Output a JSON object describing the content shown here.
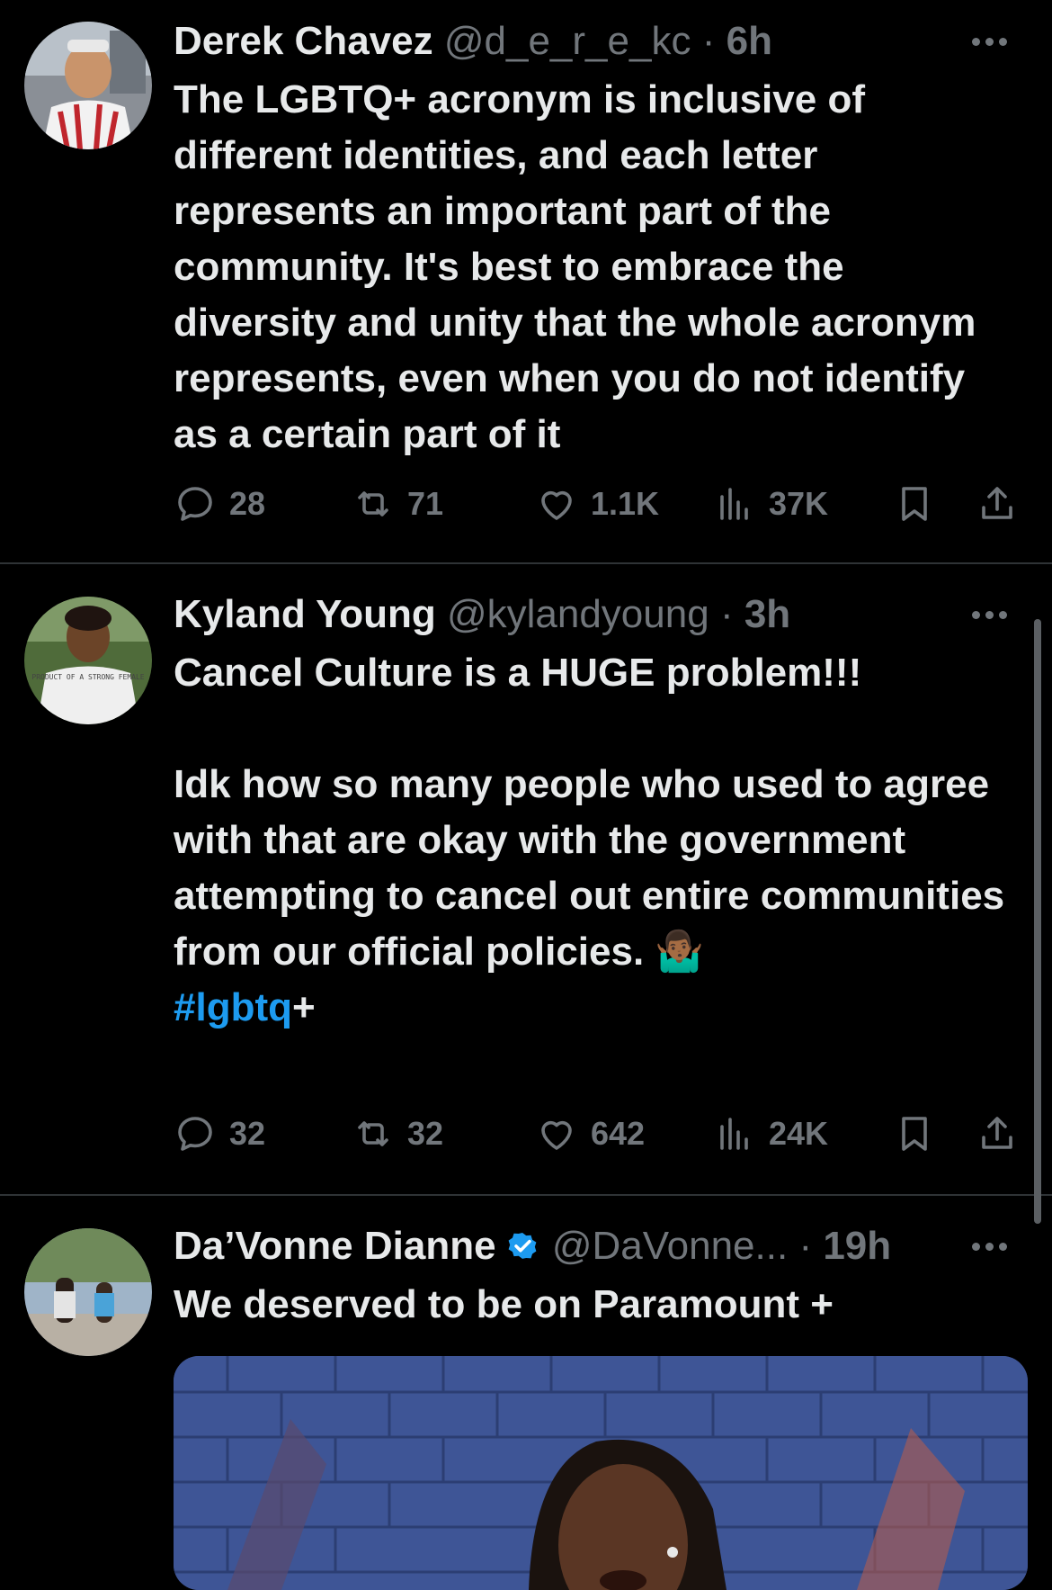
{
  "tweets": [
    {
      "name": "Derek Chavez",
      "handle": "@d_e_r_e_kc",
      "separator": "·",
      "time": "6h",
      "text": "The LGBTQ+ acronym is inclusive of different identities, and each letter represents an important part of the community. It's best to embrace the diversity and unity that the whole acronym represents, even when you do not identify as a certain part of it",
      "replies": "28",
      "retweets": "71",
      "likes": "1.1K",
      "views": "37K"
    },
    {
      "name": "Kyland Young",
      "handle": "@kylandyoung",
      "separator": "·",
      "time": "3h",
      "text_para1": "Cancel Culture is a HUGE problem!!!",
      "text_para2": "Idk how so many people who used to agree with that are okay with the government attempting to cancel out entire communities from our official policies. 🤷🏾‍♂️",
      "hashtag": "#lgbtq",
      "hashtag_suffix": "+",
      "avatar_shirt_text": "PRODUCT OF A STRONG FEMALE",
      "replies": "32",
      "retweets": "32",
      "likes": "642",
      "views": "24K"
    },
    {
      "name": "Da’Vonne Dianne",
      "verified": true,
      "handle": "@DaVonne...",
      "separator": "·",
      "time": "19h",
      "text": "We deserved to be on Paramount +"
    }
  ],
  "icons": [
    "reply-icon",
    "retweet-icon",
    "like-icon",
    "views-icon",
    "bookmark-icon",
    "share-icon",
    "more-icon",
    "verified-badge-icon"
  ],
  "colors": {
    "background": "#000000",
    "text": "#e7e9ea",
    "muted": "#71767b",
    "accent": "#1d9bf0",
    "divider": "#2f3336"
  }
}
